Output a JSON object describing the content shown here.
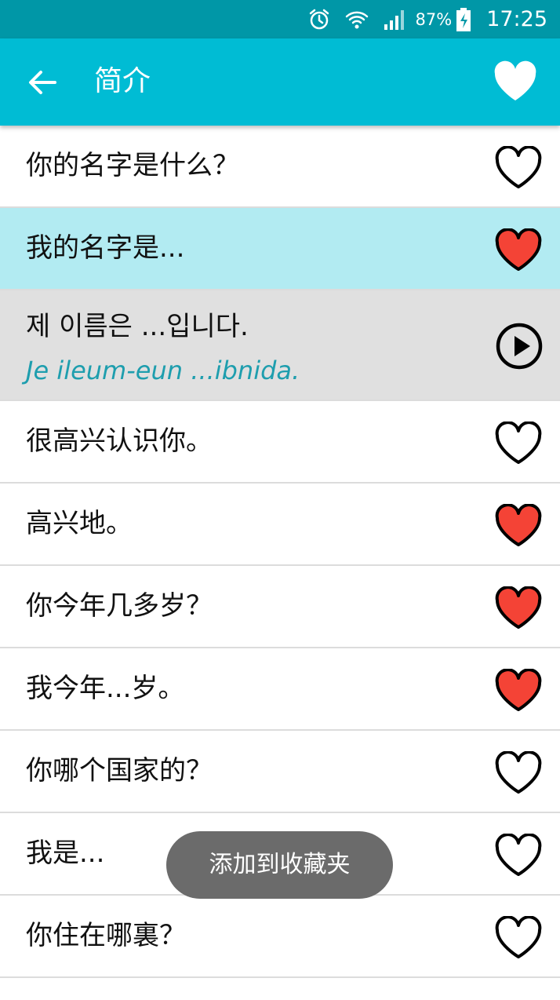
{
  "status_bar": {
    "battery_percent": "87%",
    "time": "17:25",
    "icons": [
      "alarm-icon",
      "wifi-icon",
      "signal-icon",
      "battery-charging-icon"
    ]
  },
  "app_bar": {
    "title": "简介",
    "back_icon": "arrow-left-icon",
    "favorite_icon": "heart-filled-icon"
  },
  "colors": {
    "status_bar": "#0097a7",
    "app_bar": "#00bcd4",
    "selected_row": "#b2ebf2",
    "expanded_row": "#e0e0e0",
    "romanization": "#1e9eae",
    "heart_fill": "#f44336"
  },
  "phrases": [
    {
      "text": "你的名字是什么？",
      "favorite": false
    },
    {
      "text": "我的名字是...",
      "favorite": true,
      "selected": true
    },
    {
      "korean": "제 이름은 ...입니다.",
      "romanization": "Je ileum-eun ...ibnida.",
      "icon": "play-icon"
    },
    {
      "text": "很高兴认识你。",
      "favorite": false
    },
    {
      "text": "高兴地。",
      "favorite": true
    },
    {
      "text": "你今年几多岁？",
      "favorite": true
    },
    {
      "text": "我今年...岁。",
      "favorite": true
    },
    {
      "text": "你哪个国家的？",
      "favorite": false
    },
    {
      "text": "我是...",
      "favorite": false
    },
    {
      "text": "你住在哪裏？",
      "favorite": false
    }
  ],
  "toast": {
    "message": "添加到收藏夹"
  }
}
